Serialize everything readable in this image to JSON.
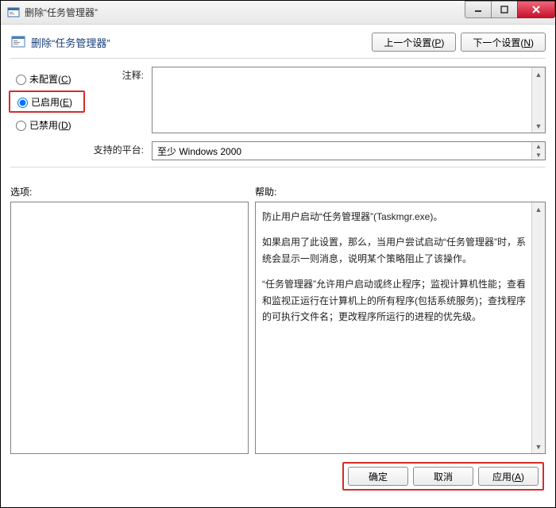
{
  "window": {
    "title": "删除“任务管理器”"
  },
  "header": {
    "title": "删除“任务管理器”",
    "prev": "上一个设置(P)",
    "next": "下一个设置(N)"
  },
  "radios": {
    "not_configured": "未配置(C)",
    "enabled": "已启用(E)",
    "disabled": "已禁用(D)",
    "selected": "enabled"
  },
  "fields": {
    "comment_label": "注释:",
    "platform_label": "支持的平台:",
    "platform_value": "至少 Windows 2000"
  },
  "labels": {
    "options": "选项:",
    "help": "帮助:"
  },
  "help": {
    "p1": "防止用户启动“任务管理器”(Taskmgr.exe)。",
    "p2": "如果启用了此设置，那么，当用户尝试启动“任务管理器”时，系统会显示一则消息，说明某个策略阻止了该操作。",
    "p3": "“任务管理器”允许用户启动或终止程序；监视计算机性能；查看和监视正运行在计算机上的所有程序(包括系统服务)；查找程序的可执行文件名；更改程序所运行的进程的优先级。"
  },
  "buttons": {
    "ok": "确定",
    "cancel": "取消",
    "apply": "应用(A)"
  }
}
